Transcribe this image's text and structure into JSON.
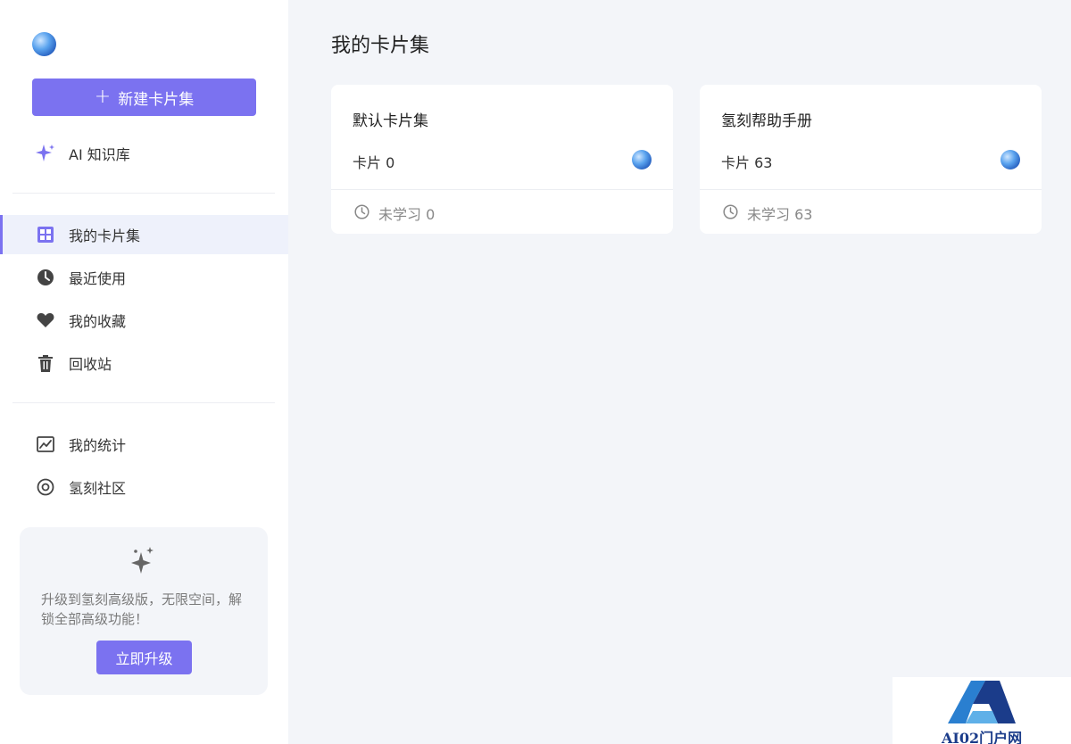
{
  "sidebar": {
    "new_button": {
      "icon": "plus-icon",
      "label": "新建卡片集"
    },
    "ai_item": {
      "icon": "sparkle-icon",
      "label": "AI 知识库"
    },
    "nav": [
      {
        "icon": "grid-icon",
        "label": "我的卡片集",
        "active": true
      },
      {
        "icon": "clock-icon",
        "label": "最近使用",
        "active": false
      },
      {
        "icon": "heart-icon",
        "label": "我的收藏",
        "active": false
      },
      {
        "icon": "trash-icon",
        "label": "回收站",
        "active": false
      }
    ],
    "nav2": [
      {
        "icon": "chart-icon",
        "label": "我的统计"
      },
      {
        "icon": "target-icon",
        "label": "氢刻社区"
      }
    ],
    "promo": {
      "icon": "sparkle-icon",
      "text": "升级到氢刻高级版，无限空间，解锁全部高级功能！",
      "button": "立即升级"
    }
  },
  "main": {
    "title": "我的卡片集",
    "cards": [
      {
        "title": "默认卡片集",
        "count": "卡片 0",
        "footer": "未学习 0"
      },
      {
        "title": "氢刻帮助手册",
        "count": "卡片 63",
        "footer": "未学习 63"
      }
    ]
  },
  "watermark": {
    "text": "AI02门户网"
  },
  "colors": {
    "accent": "#7b72f0",
    "background": "#f3f5f9",
    "active_bg": "#eef1fb"
  }
}
